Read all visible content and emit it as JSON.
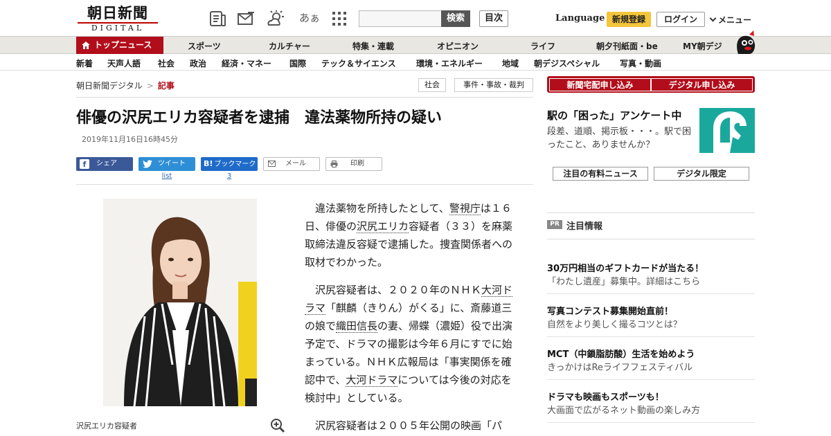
{
  "header": {
    "logo_main": "朝日新聞",
    "logo_sub": "DIGITAL",
    "icons": [
      "newspaper-icon",
      "mail-icon",
      "weather-icon",
      "font-size-icon",
      "grid-icon"
    ],
    "font_size_label": "あぁ",
    "search_placeholder": "",
    "search_label": "検索",
    "toc_label": "目次",
    "language_label": "Language",
    "register_label": "新規登録",
    "login_label": "ログイン",
    "menu_label": "メニュー"
  },
  "mainnav": {
    "top_news": "トップニュース",
    "items": [
      "スポーツ",
      "カルチャー",
      "特集・連載",
      "オピニオン",
      "ライフ",
      "朝夕刊紙面・be",
      "MY朝デジ"
    ]
  },
  "subnav": {
    "items": [
      "新着",
      "天声人語",
      "社会",
      "政治",
      "経済・マネー",
      "国際",
      "テック＆サイエンス",
      "環境・エネルギー",
      "地域",
      "朝デジスペシャル",
      "写真・動画"
    ]
  },
  "breadcrumb": {
    "home": "朝日新聞デジタル",
    "separator": ">",
    "current": "記事"
  },
  "tags": [
    "社会",
    "事件・事故・裁判"
  ],
  "article": {
    "title": "俳優の沢尻エリカ容疑者を逮捕　違法薬物所持の疑い",
    "date": "2019年11月16日16時45分",
    "share": {
      "facebook": "シェア",
      "twitter": "ツイート",
      "hatena": "ブックマーク",
      "mail": "メール",
      "print": "印刷",
      "twitter_count": "list",
      "hatena_count": "3"
    },
    "photo_caption": "沢尻エリカ容疑者",
    "p1": {
      "a": "違法薬物を所持したとして、",
      "kw1": "警視庁",
      "b": "は１６日、俳優の",
      "kw2": "沢尻エリカ",
      "c": "容疑者（３３）を麻薬取締法違反容疑で逮捕した。捜査関係者への取材でわかった。"
    },
    "p2": {
      "a": "沢尻容疑者は、２０２０年のＮＨＫ",
      "kw1": "大河ドラマ",
      "b": "「麒麟（きりん）がくる」に、斎藤道三の娘で",
      "kw2": "織田信長",
      "c": "の妻、帰蝶（濃姫）役で出演予定で、ドラマの撮影は今年６月にすでに始まっている。ＮＨＫ広報局は「事実関係を確認中で、",
      "kw3": "大河ドラマ",
      "d": "については今後の対応を検討中」としている。"
    },
    "p3": "沢尻容疑者は２００５年公開の映画「パ"
  },
  "sidebar": {
    "subscribe_paper": "新聞宅配申し込み",
    "subscribe_digital": "デジタル申し込み",
    "promo_title": "駅の「困った」アンケート中",
    "promo_text": "段差、道順、掲示板・・・。駅で困ったこと、ありませんか？",
    "btn_paid_news": "注目の有料ニュース",
    "btn_digital_only": "デジタル限定",
    "pr_badge": "PR",
    "pr_heading": "注目情報",
    "pr_items": [
      {
        "title": "30万円相当のギフトカードが当たる！",
        "desc": "「わたし遺産」募集中。詳細はこちら"
      },
      {
        "title": "写真コンテスト募集開始直前！",
        "desc": "自然をより美しく撮るコツとは？"
      },
      {
        "title": "MCT（中鎖脂肪酸）生活を始めよう",
        "desc": "きっかけはReライフフェスティバル"
      },
      {
        "title": "ドラマも映画もスポーツも！",
        "desc": "大画面で広がるネット動画の楽しみ方"
      }
    ]
  },
  "colors": {
    "brand_red": "#b20d1a",
    "register_yellow": "#f3c53b",
    "facebook_blue": "#3b5998",
    "twitter_blue": "#2f8fd6",
    "hatena_blue": "#1f6bc9",
    "link_blue": "#3066b0",
    "promo_teal": "#1aa89c"
  }
}
